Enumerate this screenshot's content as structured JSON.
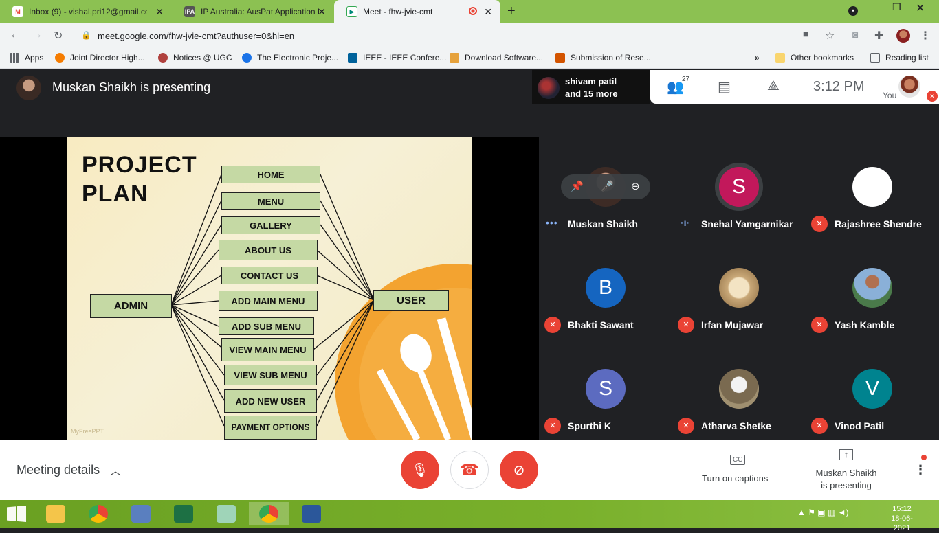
{
  "browser": {
    "tabs": [
      {
        "title": "Inbox (9) - vishal.pri12@gmail.com",
        "icon": "gmail-icon",
        "active": false
      },
      {
        "title": "IP Australia: AusPat Application D",
        "icon": "ip-australia-icon",
        "active": false
      },
      {
        "title": "Meet - fhw-jvie-cmt",
        "icon": "meet-icon",
        "active": true
      }
    ],
    "url": "meet.google.com/fhw-jvie-cmt?authuser=0&hl=en",
    "bookmarks": [
      {
        "label": "Apps",
        "color": "#5f6368"
      },
      {
        "label": "Joint Director High...",
        "color": "#f57c00"
      },
      {
        "label": "Notices @ UGC",
        "color": "#b0413e"
      },
      {
        "label": "The Electronic Proje...",
        "color": "#1a73e8"
      },
      {
        "label": "IEEE - IEEE Confere...",
        "color": "#00629b"
      },
      {
        "label": "Download Software...",
        "color": "#e6a23c"
      },
      {
        "label": "Submission of Rese...",
        "color": "#d35400"
      }
    ],
    "overflow": "»",
    "other_bookmarks": "Other bookmarks",
    "reading_list": "Reading list"
  },
  "meet": {
    "presenter_title": "Muskan Shaikh is presenting",
    "share_notice": {
      "line1": "shivam patil",
      "line2": "and 15 more"
    },
    "people_count": "27",
    "clock": "3:12 PM",
    "you_label": "You",
    "slide": {
      "title_line1": "PROJECT",
      "title_line2": "PLAN",
      "admin": "ADMIN",
      "user": "USER",
      "menu_items": [
        "HOME",
        "MENU",
        "GALLERY",
        "ABOUT US",
        "CONTACT US",
        "ADD MAIN MENU",
        "ADD SUB MENU",
        "VIEW MAIN MENU",
        "VIEW SUB MENU",
        "ADD NEW USER",
        "PAYMENT OPTIONS"
      ],
      "watermark": "MyFreePPT"
    },
    "participants": [
      {
        "name": "Muskan Shaikh",
        "initial": "",
        "color": "#5a4038",
        "status": "speaking-dots"
      },
      {
        "name": "Snehal Yamgarnikar",
        "initial": "S",
        "color": "#c2185b",
        "status": "speaking-wave"
      },
      {
        "name": "Rajashree Shendre",
        "initial": "",
        "color": "#ffffff",
        "status": "muted"
      },
      {
        "name": "Bhakti Sawant",
        "initial": "B",
        "color": "#1565c0",
        "status": "muted"
      },
      {
        "name": "Irfan Mujawar",
        "initial": "",
        "color": "#d8c4a0",
        "status": "muted"
      },
      {
        "name": "Yash Kamble",
        "initial": "",
        "color": "#4a7a4a",
        "status": "muted"
      },
      {
        "name": "Spurthi K",
        "initial": "S",
        "color": "#5c6bc0",
        "status": "muted"
      },
      {
        "name": "Atharva Shetke",
        "initial": "",
        "color": "#8a7a60",
        "status": "muted"
      },
      {
        "name": "Vinod Patil",
        "initial": "V",
        "color": "#00838f",
        "status": "muted"
      }
    ],
    "meeting_details": "Meeting details",
    "captions_label": "Turn on captions",
    "captions_icon": "CC",
    "present_label_line1": "Muskan Shaikh",
    "present_label_line2": "is presenting"
  },
  "taskbar": {
    "time": "15:12",
    "date": "18-06-2021"
  }
}
